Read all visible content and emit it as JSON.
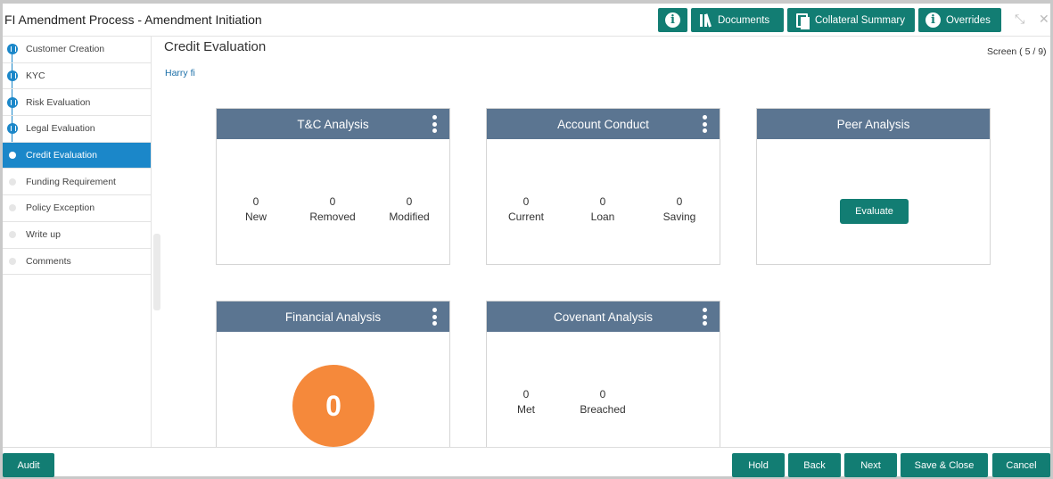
{
  "header": {
    "title": "FI Amendment Process - Amendment Initiation",
    "documents_label": "Documents",
    "collateral_label": "Collateral Summary",
    "overrides_label": "Overrides",
    "info_glyph": "i",
    "accent": "#127d73"
  },
  "sidebar": {
    "steps": [
      {
        "label": "Customer Creation",
        "state": "done"
      },
      {
        "label": "KYC",
        "state": "done"
      },
      {
        "label": "Risk Evaluation",
        "state": "done"
      },
      {
        "label": "Legal Evaluation",
        "state": "done"
      },
      {
        "label": "Credit Evaluation",
        "state": "active"
      },
      {
        "label": "Funding Requirement",
        "state": "pending"
      },
      {
        "label": "Policy Exception",
        "state": "pending"
      },
      {
        "label": "Write up",
        "state": "pending"
      },
      {
        "label": "Comments",
        "state": "pending"
      }
    ]
  },
  "main": {
    "page_title": "Credit Evaluation",
    "party_name": "Harry fi",
    "screen_count": "Screen ( 5 / 9)"
  },
  "cards": {
    "tc": {
      "title": "T&C Analysis",
      "metrics": [
        {
          "value": "0",
          "label": "New"
        },
        {
          "value": "0",
          "label": "Removed"
        },
        {
          "value": "0",
          "label": "Modified"
        }
      ]
    },
    "account": {
      "title": "Account Conduct",
      "metrics": [
        {
          "value": "0",
          "label": "Current"
        },
        {
          "value": "0",
          "label": "Loan"
        },
        {
          "value": "0",
          "label": "Saving"
        }
      ]
    },
    "peer": {
      "title": "Peer Analysis",
      "button": "Evaluate"
    },
    "financial": {
      "title": "Financial Analysis",
      "score": "0"
    },
    "covenant": {
      "title": "Covenant Analysis",
      "metrics": [
        {
          "value": "0",
          "label": "Met"
        },
        {
          "value": "0",
          "label": "Breached"
        }
      ]
    }
  },
  "footer": {
    "audit": "Audit",
    "hold": "Hold",
    "back": "Back",
    "next": "Next",
    "save_close": "Save & Close",
    "cancel": "Cancel"
  }
}
